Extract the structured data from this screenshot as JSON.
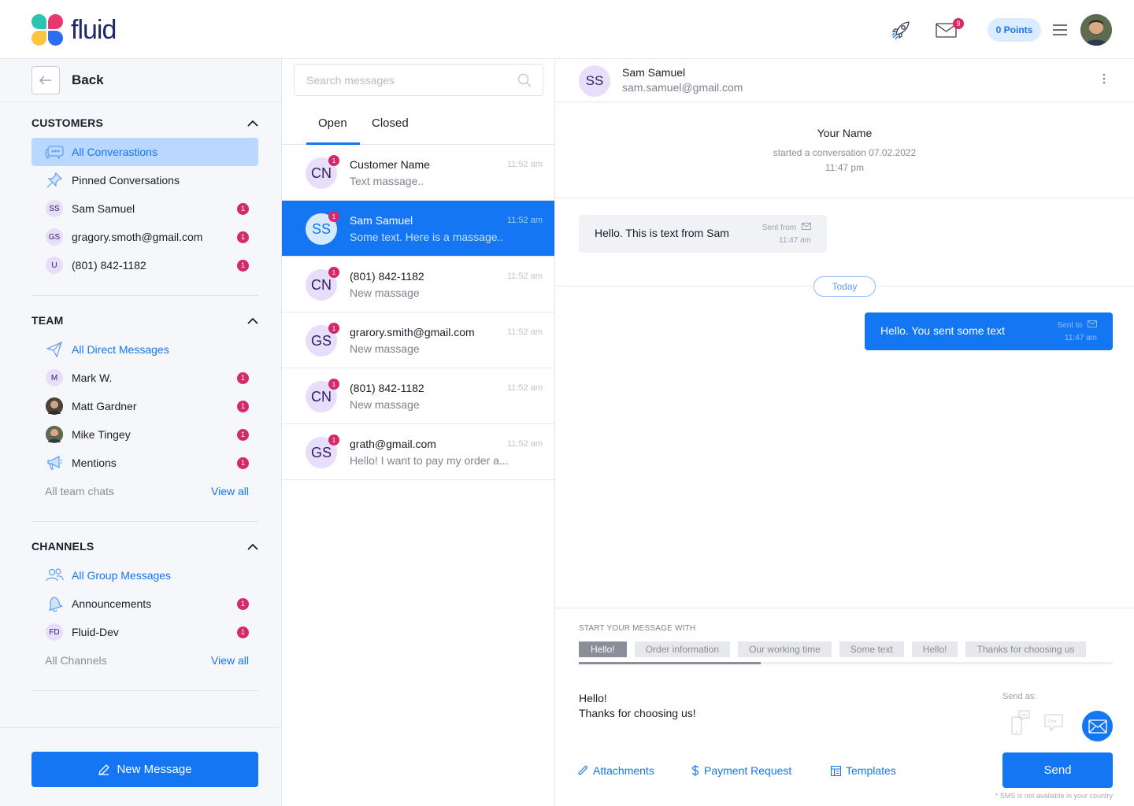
{
  "app": {
    "logo_text": "fluid",
    "points": "0 Points",
    "mail_count": "9"
  },
  "sidebar": {
    "back_label": "Back",
    "customers": {
      "title": "CUSTOMERS",
      "items": [
        {
          "label": "All Converastions"
        },
        {
          "label": "Pinned Conversations"
        },
        {
          "label": "Sam Samuel",
          "initials": "SS",
          "count": "1"
        },
        {
          "label": "gragory.smoth@gmail.com",
          "initials": "GS",
          "count": "1"
        },
        {
          "label": "(801) 842-1182",
          "initials": "U",
          "count": "1"
        }
      ]
    },
    "team": {
      "title": "TEAM",
      "items": [
        {
          "label": "All Direct Messages"
        },
        {
          "label": "Mark W.",
          "initials": "M",
          "count": "1"
        },
        {
          "label": "Matt Gardner",
          "count": "1"
        },
        {
          "label": "Mike Tingey",
          "count": "1"
        },
        {
          "label": "Mentions",
          "count": "1"
        }
      ],
      "footer_label": "All team chats",
      "footer_link": "View all"
    },
    "channels": {
      "title": "CHANNELS",
      "items": [
        {
          "label": "All Group Messages"
        },
        {
          "label": "Announcements",
          "count": "1"
        },
        {
          "label": "Fluid-Dev",
          "initials": "FD",
          "count": "1"
        }
      ],
      "footer_label": "All Channels",
      "footer_link": "View all"
    },
    "new_message": "New Message"
  },
  "list": {
    "search_placeholder": "Search messages",
    "tabs": [
      "Open",
      "Closed"
    ],
    "conversations": [
      {
        "initials": "CN",
        "badge": "1",
        "name": "Customer Name",
        "time": "11:52 am",
        "preview": "Text massage.."
      },
      {
        "initials": "SS",
        "badge": "1",
        "name": "Sam Samuel",
        "time": "11:52 am",
        "preview": "Some text. Here is a massage.."
      },
      {
        "initials": "CN",
        "badge": "1",
        "name": "(801) 842-1182",
        "time": "11:52 am",
        "preview": "New massage"
      },
      {
        "initials": "GS",
        "badge": "1",
        "name": "grarory.smith@gmail.com",
        "time": "11:52 am",
        "preview": "New massage"
      },
      {
        "initials": "CN",
        "badge": "1",
        "name": "(801) 842-1182",
        "time": "11:52 am",
        "preview": "New massage"
      },
      {
        "initials": "GS",
        "badge": "1",
        "name": "grath@gmail.com",
        "time": "11:52 am",
        "preview": "Hello! I want to pay my order a..."
      }
    ]
  },
  "chat": {
    "contact": {
      "initials": "SS",
      "name": "Sam Samuel",
      "email": "sam.samuel@gmail.com"
    },
    "started": {
      "name": "Your Name",
      "line1": "started a conversation 07.02.2022",
      "line2": "11:47 pm"
    },
    "incoming": {
      "text": "Hello. This is text from Sam",
      "meta_label": "Sent from",
      "time": "11:47 am"
    },
    "divider": "Today",
    "outgoing": {
      "text": "Hello. You sent some text",
      "meta_label": "Sent to",
      "time": "11:47 am"
    },
    "composer": {
      "start_label": "START YOUR MESSAGE WITH",
      "chips": [
        "Hello!",
        "Order information",
        "Our working time",
        "Some text",
        "Hello!",
        "Thanks for choosing us"
      ],
      "chips_scroll_fraction": 0.34,
      "text_line1": "Hello!",
      "text_line2": "Thanks for choosing us!",
      "send_as": "Send as:",
      "channel_sms": "SMS",
      "channel_chat": "Chat",
      "attachments": "Attachments",
      "payment_request": "Payment Request",
      "templates": "Templates",
      "send": "Send",
      "disclaimer": "* SMS is not available in your country"
    }
  },
  "colors": {
    "primary": "#1476f2",
    "badge": "#d42a6b",
    "active_bg": "#b9d7ff"
  }
}
